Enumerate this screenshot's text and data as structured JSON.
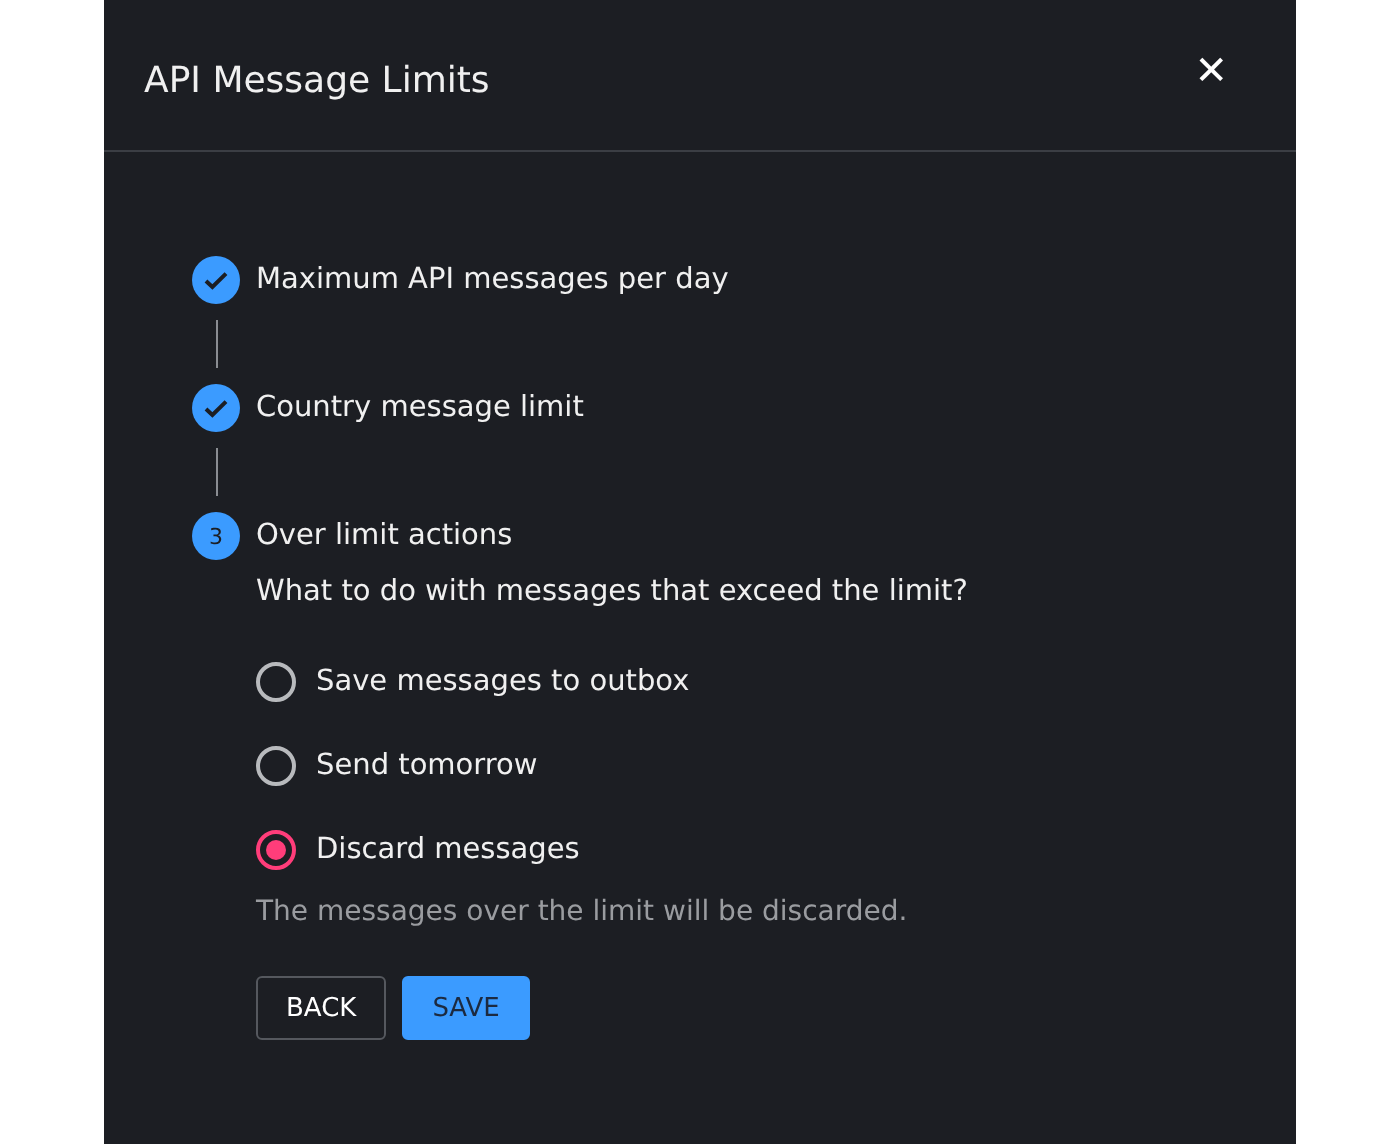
{
  "dialog": {
    "title": "API Message Limits",
    "close": "✕"
  },
  "steps": [
    {
      "label": "Maximum API messages per day",
      "completed": true
    },
    {
      "label": "Country message limit",
      "completed": true
    },
    {
      "label": "Over limit actions",
      "completed": false,
      "number": "3"
    }
  ],
  "question": "What to do with messages that exceed the limit?",
  "options": [
    {
      "label": "Save messages to outbox",
      "selected": false
    },
    {
      "label": "Send tomorrow",
      "selected": false
    },
    {
      "label": "Discard messages",
      "selected": true
    }
  ],
  "hint": "The messages over the limit will be discarded.",
  "buttons": [
    {
      "label": "BACK",
      "kind": "secondary"
    },
    {
      "label": "SAVE",
      "kind": "primary"
    }
  ]
}
